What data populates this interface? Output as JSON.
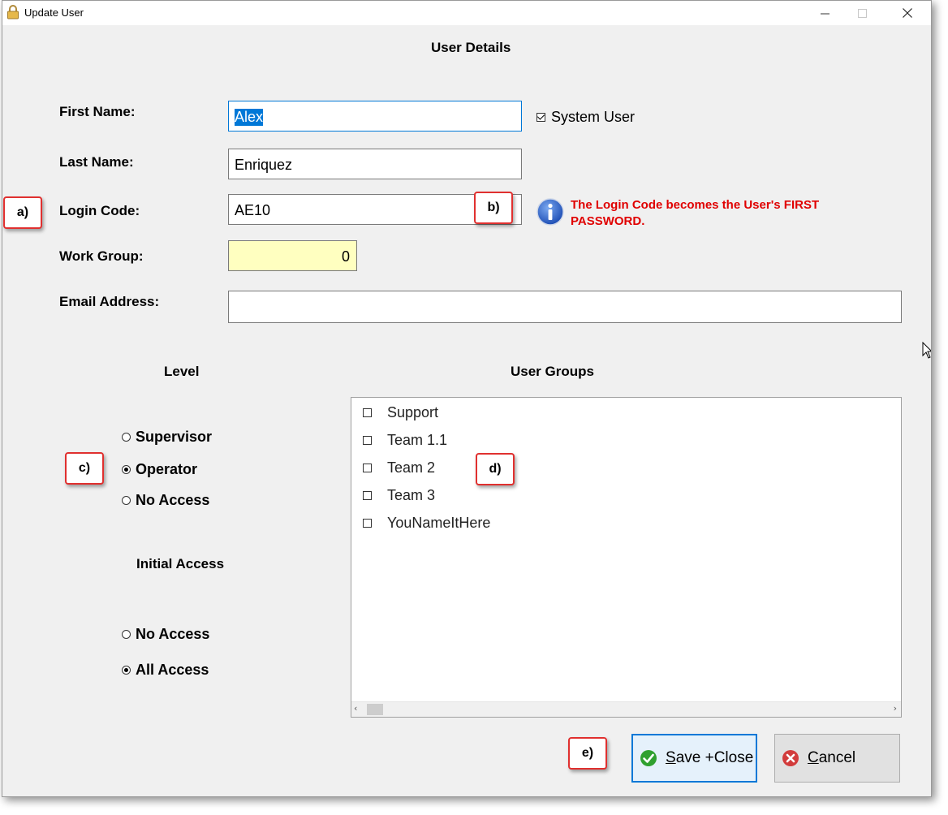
{
  "window": {
    "title": "Update User",
    "heading": "User Details"
  },
  "form": {
    "first_name_label": "First Name:",
    "first_name_value": "Alex",
    "last_name_label": "Last Name:",
    "last_name_value": "Enriquez",
    "login_code_label": "Login Code:",
    "login_code_value": "AE10",
    "work_group_label": "Work Group:",
    "work_group_value": "0",
    "email_label": "Email Address:",
    "email_value": "",
    "system_user_label": "System User",
    "system_user_checked": true,
    "info_text": "The Login Code becomes the User's FIRST PASSWORD."
  },
  "level": {
    "heading": "Level",
    "options": [
      "Supervisor",
      "Operator",
      "No Access"
    ],
    "selected": "Operator"
  },
  "initial_access": {
    "heading": "Initial Access",
    "options": [
      "No Access",
      "All Access"
    ],
    "selected": "All Access"
  },
  "user_groups": {
    "heading": "User Groups",
    "items": [
      "Support",
      "Team 1.1",
      "Team 2",
      "Team 3",
      "YouNameItHere"
    ]
  },
  "buttons": {
    "save_label_underlined": "S",
    "save_label_rest": "ave +Close",
    "cancel_label_underlined": "C",
    "cancel_label_rest": "ancel"
  },
  "callouts": [
    "a)",
    "b)",
    "c)",
    "d)",
    "e)"
  ],
  "colors": {
    "accent": "#0078d7",
    "info_text": "#e00000",
    "callout_border": "#e0302f",
    "work_group_bg": "#ffffc0"
  },
  "icons": {
    "title": "padlock-icon",
    "info": "info-icon",
    "save": "check-icon",
    "cancel": "cancel-icon"
  }
}
